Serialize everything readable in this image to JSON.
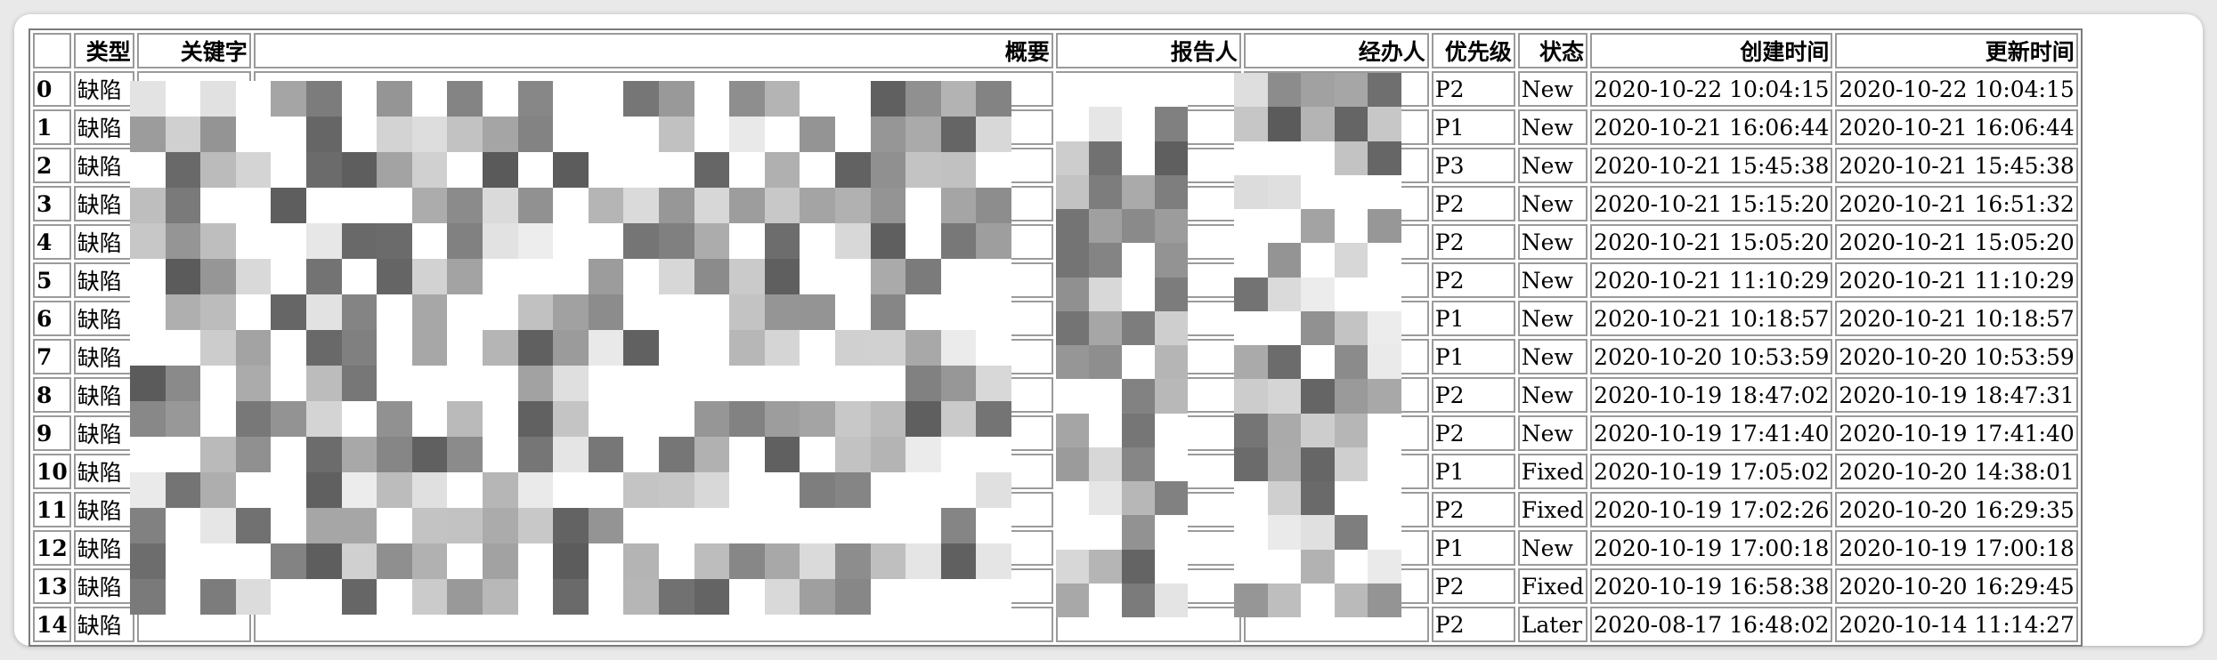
{
  "headers": [
    "",
    "类型",
    "关键字",
    "概要",
    "报告人",
    "经办人",
    "优先级",
    "状态",
    "创建时间",
    "更新时间"
  ],
  "rows": [
    {
      "idx": "0",
      "type": "缺陷",
      "priority": "P2",
      "status": "New",
      "created": "2020-10-22 10:04:15",
      "updated": "2020-10-22 10:04:15"
    },
    {
      "idx": "1",
      "type": "缺陷",
      "priority": "P1",
      "status": "New",
      "created": "2020-10-21 16:06:44",
      "updated": "2020-10-21 16:06:44"
    },
    {
      "idx": "2",
      "type": "缺陷",
      "priority": "P3",
      "status": "New",
      "created": "2020-10-21 15:45:38",
      "updated": "2020-10-21 15:45:38"
    },
    {
      "idx": "3",
      "type": "缺陷",
      "priority": "P2",
      "status": "New",
      "created": "2020-10-21 15:15:20",
      "updated": "2020-10-21 16:51:32"
    },
    {
      "idx": "4",
      "type": "缺陷",
      "priority": "P2",
      "status": "New",
      "created": "2020-10-21 15:05:20",
      "updated": "2020-10-21 15:05:20"
    },
    {
      "idx": "5",
      "type": "缺陷",
      "priority": "P2",
      "status": "New",
      "created": "2020-10-21 11:10:29",
      "updated": "2020-10-21 11:10:29"
    },
    {
      "idx": "6",
      "type": "缺陷",
      "priority": "P1",
      "status": "New",
      "created": "2020-10-21 10:18:57",
      "updated": "2020-10-21 10:18:57"
    },
    {
      "idx": "7",
      "type": "缺陷",
      "priority": "P1",
      "status": "New",
      "created": "2020-10-20 10:53:59",
      "updated": "2020-10-20 10:53:59"
    },
    {
      "idx": "8",
      "type": "缺陷",
      "priority": "P2",
      "status": "New",
      "created": "2020-10-19 18:47:02",
      "updated": "2020-10-19 18:47:31"
    },
    {
      "idx": "9",
      "type": "缺陷",
      "priority": "P2",
      "status": "New",
      "created": "2020-10-19 17:41:40",
      "updated": "2020-10-19 17:41:40"
    },
    {
      "idx": "10",
      "type": "缺陷",
      "priority": "P1",
      "status": "Fixed",
      "created": "2020-10-19 17:05:02",
      "updated": "2020-10-20 14:38:01"
    },
    {
      "idx": "11",
      "type": "缺陷",
      "priority": "P2",
      "status": "Fixed",
      "created": "2020-10-19 17:02:26",
      "updated": "2020-10-20 16:29:35"
    },
    {
      "idx": "12",
      "type": "缺陷",
      "priority": "P1",
      "status": "New",
      "created": "2020-10-19 17:00:18",
      "updated": "2020-10-19 17:00:18"
    },
    {
      "idx": "13",
      "type": "缺陷",
      "priority": "P2",
      "status": "Fixed",
      "created": "2020-10-19 16:58:38",
      "updated": "2020-10-20 16:29:45"
    },
    {
      "idx": "14",
      "type": "缺陷",
      "priority": "P2",
      "status": "Later",
      "created": "2020-08-17 16:48:02",
      "updated": "2020-10-14 11:14:27"
    }
  ],
  "colors": {
    "page_bg": "#e9e9e9",
    "window_bg": "#ffffff",
    "cell_border": "#9a9a9a",
    "table_border": "#7b7b7b"
  }
}
